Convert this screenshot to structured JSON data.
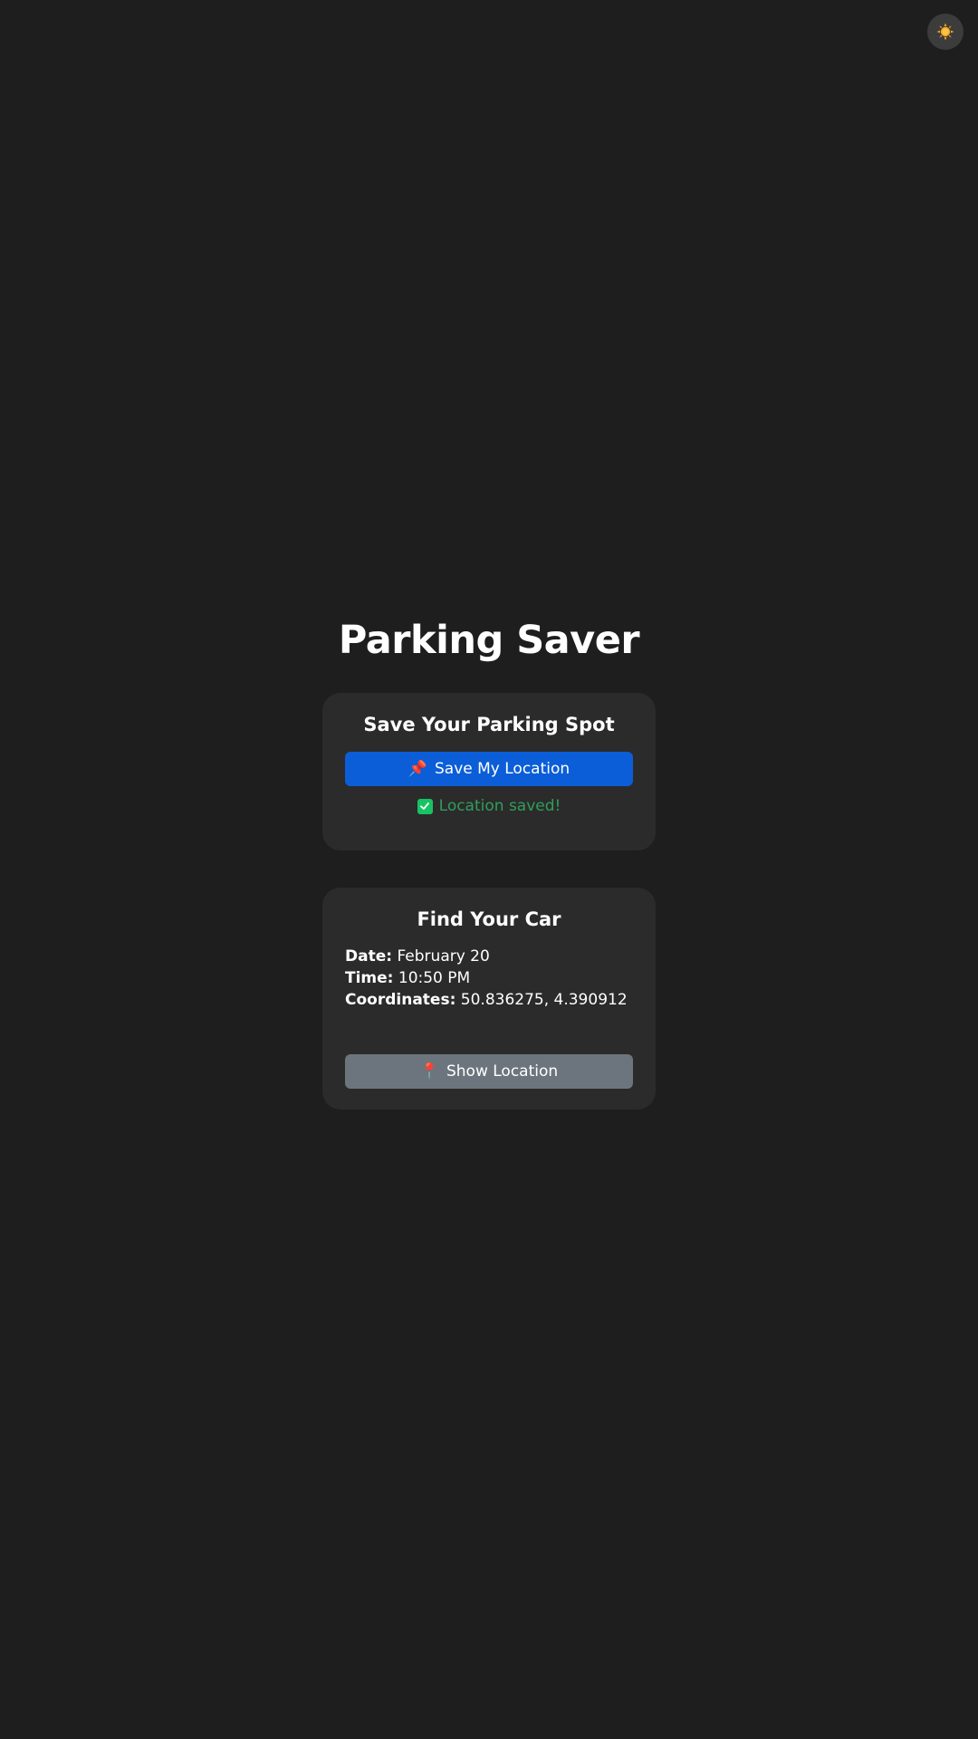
{
  "theme_toggle": {
    "icon": "sun-icon",
    "color": "#f5a623"
  },
  "app": {
    "title": "Parking Saver"
  },
  "save_card": {
    "heading": "Save Your Parking Spot",
    "button_icon": "📌",
    "button_label": "Save My Location",
    "status_text": "Location saved!",
    "status_color": "#2f9e5b"
  },
  "find_card": {
    "heading": "Find Your Car",
    "date_label": "Date:",
    "date_value": "February 20",
    "time_label": "Time:",
    "time_value": "10:50 PM",
    "coords_label": "Coordinates:",
    "coords_value": "50.836275, 4.390912",
    "button_icon": "📍",
    "button_label": "Show Location"
  },
  "colors": {
    "background": "#1e1e1e",
    "card": "#2b2b2b",
    "primary": "#0b5ed7",
    "secondary": "#6c757d"
  }
}
